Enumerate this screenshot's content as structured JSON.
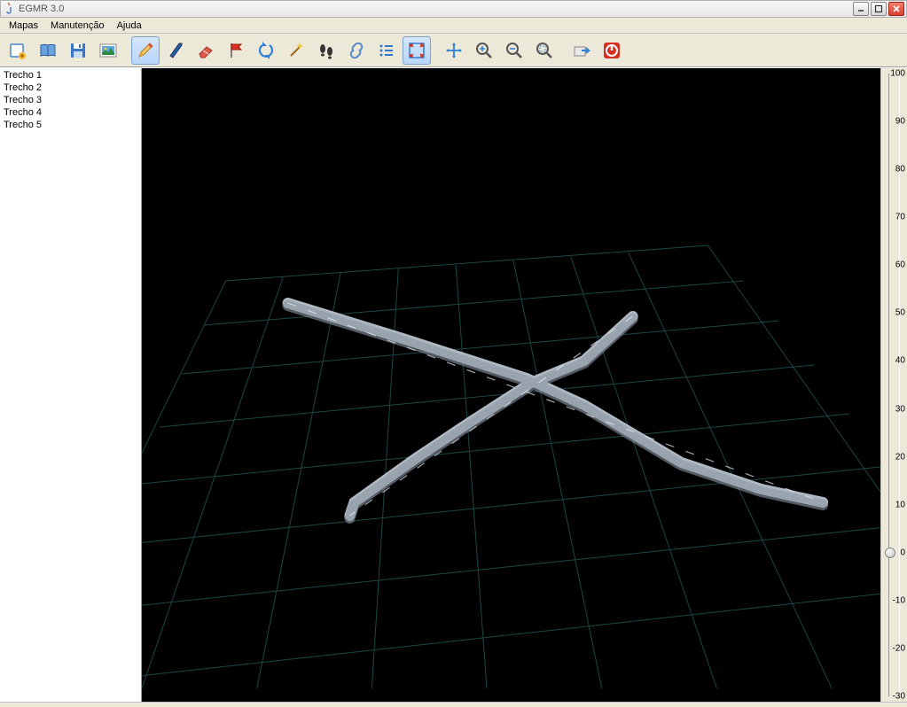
{
  "window": {
    "title": "EGMR 3.0"
  },
  "menu": {
    "items": [
      "Mapas",
      "Manutenção",
      "Ajuda"
    ]
  },
  "sidebar": {
    "items": [
      "Trecho 1",
      "Trecho 2",
      "Trecho 3",
      "Trecho 4",
      "Trecho 5"
    ]
  },
  "zscale": {
    "ticks": [
      100,
      90,
      80,
      70,
      60,
      50,
      40,
      30,
      20,
      10,
      0,
      -10,
      -20,
      -30
    ],
    "value": 0
  },
  "toolbar": {
    "buttons": [
      "new-map",
      "book",
      "save",
      "image",
      "sep",
      "pencil",
      "pen",
      "eraser",
      "flag",
      "refresh",
      "wand",
      "footprints",
      "link",
      "list",
      "fit",
      "sep",
      "move",
      "zoom-in",
      "zoom-out",
      "zoom-region",
      "sep",
      "export",
      "power"
    ],
    "selected": [
      "pencil",
      "fit"
    ]
  }
}
